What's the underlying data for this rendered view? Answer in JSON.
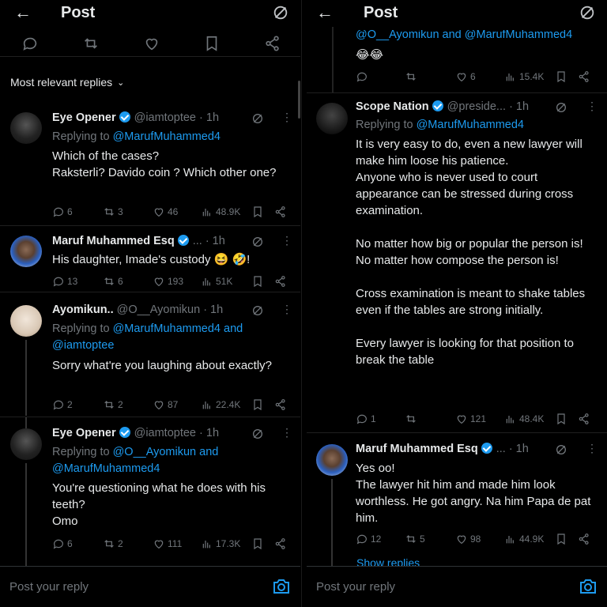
{
  "left": {
    "header": {
      "title": "Post"
    },
    "section": {
      "label": "Most relevant replies"
    },
    "replies": [
      {
        "name": "Eye Opener",
        "handle": "@iamtoptee",
        "time": "· 1h",
        "replying_prefix": "Replying to ",
        "replying_to": "@MarufMuhammed4",
        "text": "Which of the cases?\nRaksterli? Davido coin ? Which other one?",
        "stats": {
          "replies": "6",
          "reposts": "3",
          "likes": "46",
          "views": "48.9K"
        }
      },
      {
        "name": "Maruf Muhammed Esq",
        "handle": "...",
        "time": "· 1h",
        "text": "His daughter, Imade's custody 😆 🤣!",
        "stats": {
          "replies": "13",
          "reposts": "6",
          "likes": "193",
          "views": "51K"
        }
      },
      {
        "name": "Ayomikun..",
        "handle": "@O__Ayomikun",
        "time": "· 1h",
        "replying_prefix": "Replying to ",
        "replying_to": "@MarufMuhammed4 and @iamtoptee",
        "text": "Sorry what're you laughing about exactly?",
        "stats": {
          "replies": "2",
          "reposts": "2",
          "likes": "87",
          "views": "22.4K"
        }
      },
      {
        "name": "Eye Opener",
        "handle": "@iamtoptee",
        "time": "· 1h",
        "replying_prefix": "Replying to ",
        "replying_to": "@O__Ayomikun and @MarufMuhammed4",
        "text": "You're questioning what he does with his teeth?\nOmo",
        "stats": {
          "replies": "6",
          "reposts": "2",
          "likes": "111",
          "views": "17.3K"
        }
      }
    ],
    "composer": {
      "placeholder": "Post your reply"
    }
  },
  "right": {
    "header": {
      "title": "Post"
    },
    "top_fragment": {
      "mentions": "@O__Ayomikun and @MarufMuhammed4",
      "emojis": "😂😂",
      "stats": {
        "replies": "",
        "reposts": "",
        "likes": "6",
        "views": "15.4K"
      }
    },
    "replies": [
      {
        "name": "Scope Nation",
        "handle": "@preside...",
        "time": "· 1h",
        "replying_prefix": "Replying to ",
        "replying_to": "@MarufMuhammed4",
        "text": "It is very easy to do, even a new lawyer will make him loose his patience.\nAnyone who is never used to court appearance can be stressed during cross examination.\n\nNo matter how big or popular the person is!\nNo matter how compose the person is!\n\nCross examination is meant to shake tables even if the tables are strong initially.\n\nEvery lawyer is looking for that position to break the table",
        "stats": {
          "replies": "1",
          "reposts": "",
          "likes": "121",
          "views": "48.4K"
        }
      },
      {
        "name": "Maruf Muhammed Esq",
        "handle": "...",
        "time": "· 1h",
        "text": "Yes oo!\nThe lawyer hit him and made him look worthless. He got angry. Na him Papa de pat him.",
        "stats": {
          "replies": "12",
          "reposts": "5",
          "likes": "98",
          "views": "44.9K"
        }
      }
    ],
    "show_replies": "Show replies",
    "composer": {
      "placeholder": "Post your reply"
    }
  },
  "colors": {
    "background": "#000000",
    "text": "#e7e9ea",
    "muted": "#71767b",
    "accent": "#1d9bf0"
  }
}
